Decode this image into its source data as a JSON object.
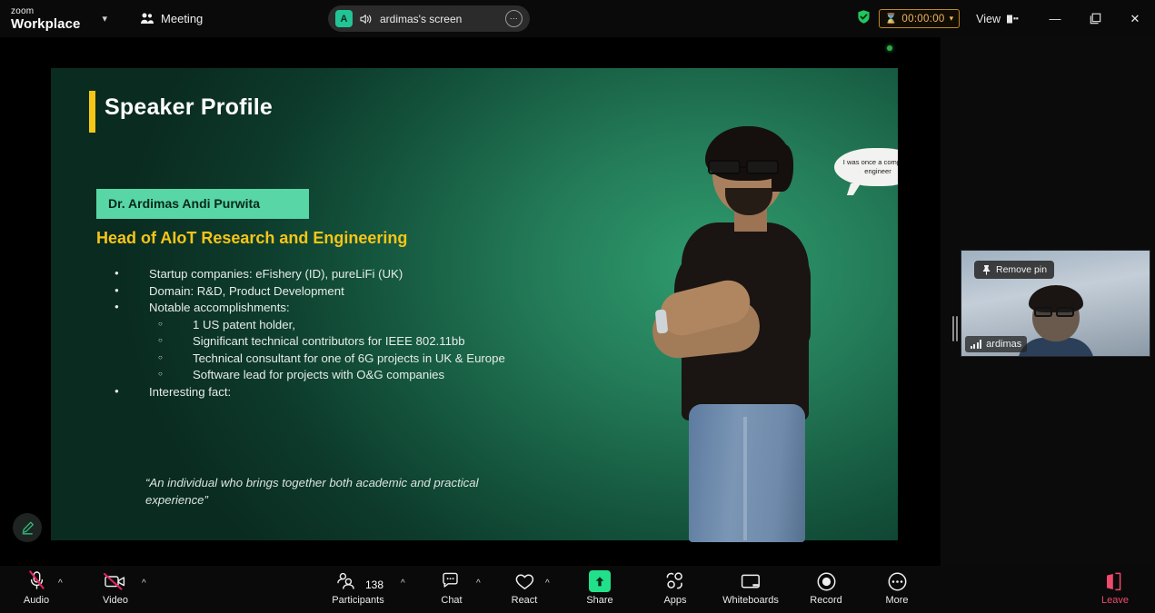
{
  "app": {
    "brand_top": "zoom",
    "brand_bottom": "Workplace",
    "brand_chevron": "chevron-down"
  },
  "topbar": {
    "meeting_label": "Meeting",
    "meeting_icon": "people-icon",
    "share_pill": {
      "avatar_initial": "A",
      "speaker_icon": "speaker-icon",
      "label": "ardimas's screen",
      "more_label": "⋯"
    },
    "security_icon": "shield-check-icon",
    "timer": {
      "icon": "hourglass-icon",
      "value": "00:00:00",
      "chevron": "∨"
    },
    "view_label": "View",
    "view_icon": "layout-icon",
    "window_controls": {
      "minimize": "—",
      "maximize": "❐",
      "close": "✕"
    }
  },
  "shared_screen": {
    "recording_dot": "green-dot",
    "annotate_icon": "pencil-icon",
    "slide": {
      "title": "Speaker Profile",
      "name_chip": "Dr. Ardimas Andi Purwita",
      "role": "Head of AIoT Research and Engineering",
      "bullets": [
        {
          "level": 1,
          "text": "Startup companies: eFishery (ID), pureLiFi (UK)"
        },
        {
          "level": 1,
          "text": "Domain: R&D, Product Development"
        },
        {
          "level": 1,
          "text": "Notable accomplishments:"
        },
        {
          "level": 2,
          "text": "1 US patent holder,"
        },
        {
          "level": 2,
          "text": "Significant technical contributors for IEEE 802.11bb"
        },
        {
          "level": 2,
          "text": "Technical consultant for one of 6G projects in UK & Europe"
        },
        {
          "level": 2,
          "text": "Software lead for projects with O&G companies"
        },
        {
          "level": 1,
          "text": "Interesting fact:"
        }
      ],
      "quote": "“An individual who brings together both academic and practical experience”",
      "speech_bubble": "I was once a computer engineer"
    }
  },
  "self_view": {
    "pin_icon": "pin-icon",
    "pin_label": "Remove pin",
    "signal_icon": "signal-bars-icon",
    "participant_name": "ardimas",
    "drag_handle": "resize-handle"
  },
  "toolbar": {
    "items": [
      {
        "name": "audio",
        "label": "Audio",
        "icon": "microphone-muted-icon",
        "caret": "^",
        "muted": true
      },
      {
        "name": "video",
        "label": "Video",
        "icon": "camera-muted-icon",
        "caret": "^",
        "muted": true
      },
      {
        "name": "participants",
        "label": "Participants",
        "icon": "people-icon",
        "caret": "^",
        "count": "138"
      },
      {
        "name": "chat",
        "label": "Chat",
        "icon": "chat-bubble-icon",
        "caret": "^"
      },
      {
        "name": "react",
        "label": "React",
        "icon": "heart-icon",
        "caret": "^"
      },
      {
        "name": "share",
        "label": "Share",
        "icon": "share-screen-icon"
      },
      {
        "name": "apps",
        "label": "Apps",
        "icon": "apps-icon"
      },
      {
        "name": "whiteboards",
        "label": "Whiteboards",
        "icon": "whiteboard-icon"
      },
      {
        "name": "record",
        "label": "Record",
        "icon": "record-icon"
      },
      {
        "name": "more",
        "label": "More",
        "icon": "ellipsis-icon"
      },
      {
        "name": "leave",
        "label": "Leave",
        "icon": "leave-door-icon"
      }
    ]
  },
  "colors": {
    "accent_green": "#22e08a",
    "brand_teal": "#59d6a5",
    "slide_yellow": "#f5c518",
    "timer_amber": "#e6b860",
    "leave_red": "#ef4a6b",
    "mute_slash": "#e0245e"
  }
}
